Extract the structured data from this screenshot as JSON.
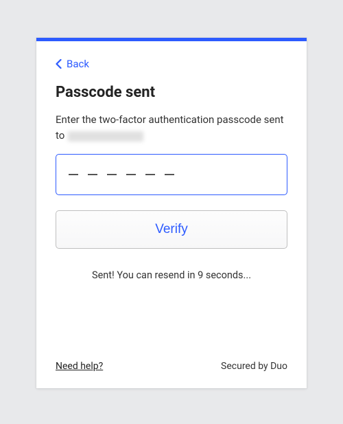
{
  "back": {
    "label": "Back"
  },
  "title": "Passcode sent",
  "instruction": {
    "prefix": "Enter the two-factor authentication passcode sent to "
  },
  "passcode": {
    "value": "",
    "slots": 6
  },
  "verify": {
    "label": "Verify"
  },
  "status": {
    "message": "Sent! You can resend in 9 seconds..."
  },
  "footer": {
    "help_label": "Need help?",
    "secured_label": "Secured by Duo"
  },
  "colors": {
    "accent": "#2d5bff"
  }
}
